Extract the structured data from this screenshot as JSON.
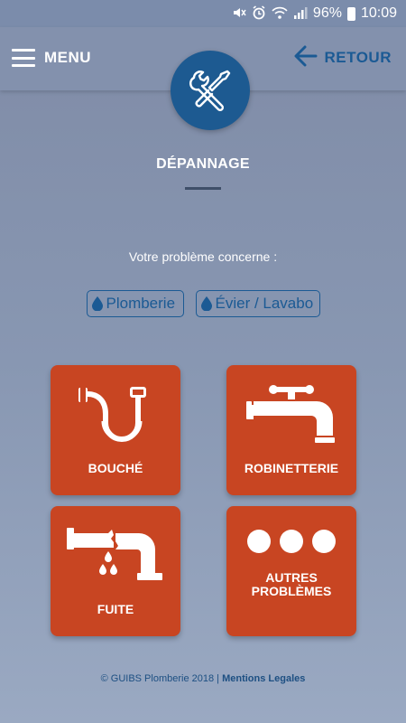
{
  "status_bar": {
    "battery": "96%",
    "time": "10:09"
  },
  "header": {
    "menu_label": "MENU",
    "back_label": "RETOUR"
  },
  "page": {
    "title": "DÉPANNAGE",
    "question": "Votre problème concerne :",
    "chips": [
      {
        "label": "Plomberie",
        "icon": "water-drop-icon"
      },
      {
        "label": "Évier / Lavabo",
        "icon": "water-drop-icon"
      }
    ]
  },
  "tiles": [
    {
      "label": "BOUCHÉ",
      "icon": "clogged-pipe-icon"
    },
    {
      "label": "ROBINETTERIE",
      "icon": "faucet-icon"
    },
    {
      "label": "FUITE",
      "icon": "leaking-pipe-icon"
    },
    {
      "label": "AUTRES PROBLÈMES",
      "line1": "AUTRES",
      "line2": "PROBLÈMES",
      "icon": "three-dots-icon"
    }
  ],
  "footer": {
    "copyright": "© GUIBS Plomberie 2018 | ",
    "link": "Mentions Legales"
  },
  "colors": {
    "tile": "#c84522",
    "accent": "#1b5a94"
  }
}
